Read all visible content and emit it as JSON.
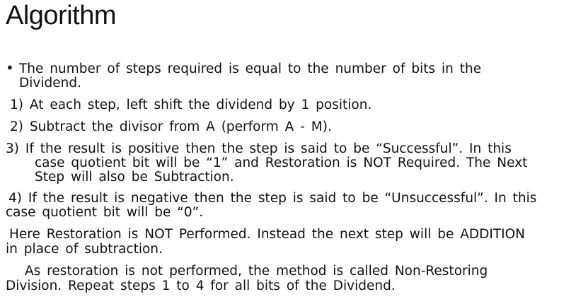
{
  "title": "Algorithm",
  "paragraphs": {
    "bullet": {
      "marker": "•",
      "line1": "The number of steps required is equal to the number of bits in the",
      "line2": "Dividend."
    },
    "step1": "1) At each step, left shift the dividend by 1 position.",
    "step2": "2) Subtract the divisor from A (perform A - M).",
    "step3": {
      "line1": "3)   If the result is positive then the step is said to be “Successful”. In this",
      "line2": "case quotient bit will be “1” and Restoration is NOT Required. The Next",
      "line3": "Step will also be Subtraction."
    },
    "step4": {
      "line1": "4) If the result is negative then the step is said to be “Unsuccessful”. In this",
      "line2": "case quotient bit will be “0”."
    },
    "note": {
      "line1": "Here Restoration is NOT Performed. Instead the next step will be ADDITION",
      "line2": "in place of subtraction."
    },
    "conclusion": {
      "line1": "As restoration is not performed, the method is called Non-Restoring",
      "line2": "Division.  Repeat steps 1 to 4 for all bits of the Dividend."
    }
  }
}
